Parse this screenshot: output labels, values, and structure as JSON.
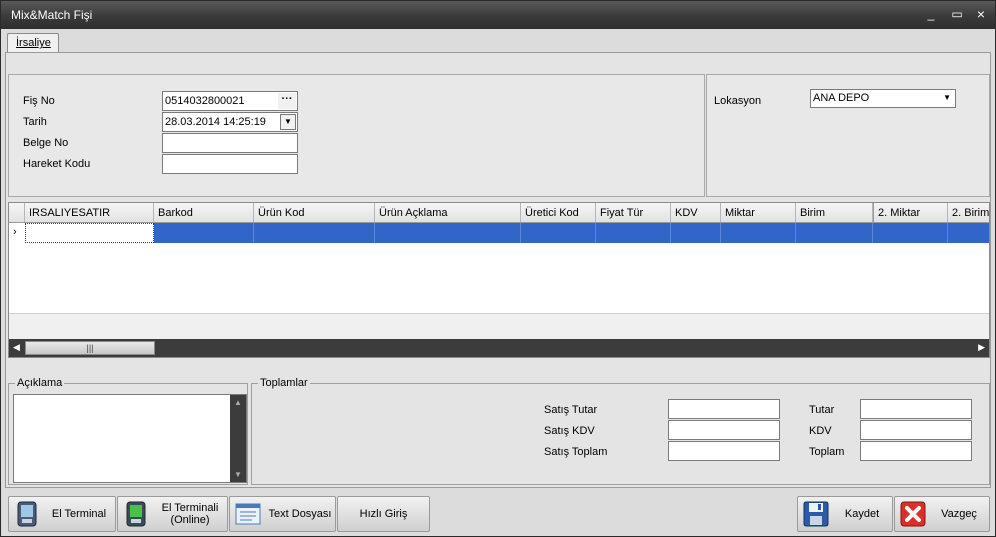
{
  "window": {
    "title": "Mix&Match Fişi",
    "minimize": "_",
    "maximize": "▭",
    "close": "×"
  },
  "tabs": [
    {
      "label": "İrsaliye"
    }
  ],
  "form": {
    "fis_no_label": "Fiş No",
    "fis_no_value": "0514032800021",
    "tarih_label": "Tarih",
    "tarih_value": "28.03.2014 14:25:19",
    "belge_no_label": "Belge No",
    "belge_no_value": "",
    "hareket_kodu_label": "Hareket Kodu",
    "hareket_kodu_value": "",
    "lokasyon_label": "Lokasyon",
    "lokasyon_value": "ANA DEPO"
  },
  "grid": {
    "columns": [
      "IRSALIYESATIR",
      "Barkod",
      "Ürün Kod",
      "Ürün Açklama",
      "Üretici Kod",
      "Fiyat Tür",
      "KDV",
      "Miktar",
      "Birim",
      "2. Miktar",
      "2. Birim"
    ],
    "row_indicator": "›"
  },
  "aciklama": {
    "label": "Açıklama",
    "value": ""
  },
  "toplamlar": {
    "label": "Toplamlar",
    "satis_tutar_label": "Satış Tutar",
    "satis_kdv_label": "Satış KDV",
    "satis_toplam_label": "Satış Toplam",
    "tutar_label": "Tutar",
    "kdv_label": "KDV",
    "toplam_label": "Toplam"
  },
  "buttons": {
    "el_terminal": "El Terminal",
    "el_terminali_online_1": "El Terminali",
    "el_terminali_online_2": "(Online)",
    "text_dosyasi": "Text Dosyası",
    "hizli_giris": "Hızlı Giriş",
    "kaydet": "Kaydet",
    "vazgec": "Vazgeç"
  },
  "colors": {
    "selection": "#3166c8",
    "titlebar": "#3c3c3c",
    "cancel": "#d9302a"
  }
}
